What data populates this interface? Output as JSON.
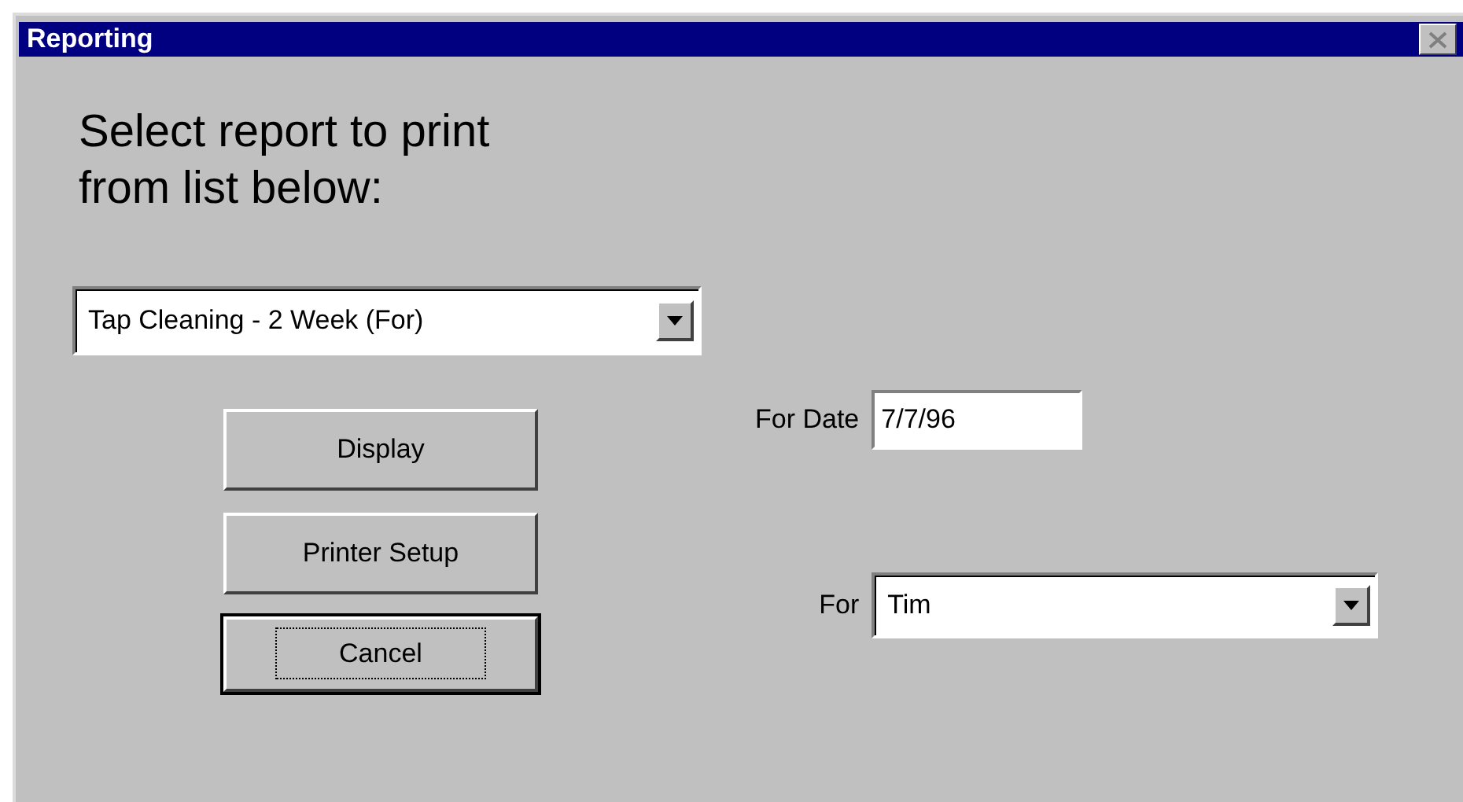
{
  "window": {
    "title": "Reporting"
  },
  "heading": "Select report to print\nfrom list below:",
  "report_select": {
    "value": "Tap Cleaning - 2 Week (For)"
  },
  "buttons": [
    {
      "label": "Display",
      "focused": false
    },
    {
      "label": "Printer Setup",
      "focused": false
    },
    {
      "label": "Cancel",
      "focused": true
    }
  ],
  "for_date": {
    "label": "For Date",
    "value": "7/7/96"
  },
  "for": {
    "label": "For",
    "value": "Tim"
  }
}
